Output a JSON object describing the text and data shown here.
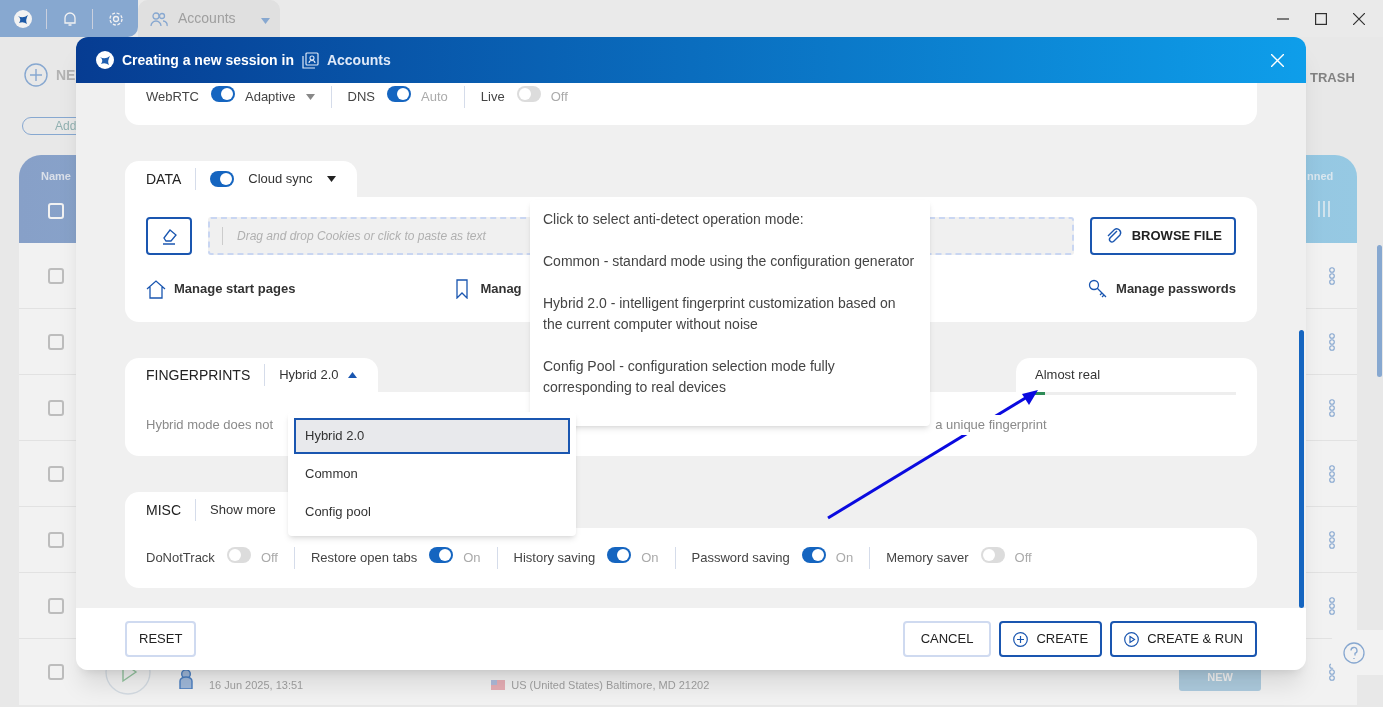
{
  "app": {
    "tab": {
      "label": "Accounts"
    },
    "toolbar": {
      "new_label": "NE",
      "add_label": "Add",
      "trash_label": "TRASH"
    },
    "table": {
      "header_checked": false,
      "columns": [
        {
          "label": "Name"
        },
        {
          "label": "nned"
        }
      ],
      "rows": [
        {
          "checked": false
        },
        {
          "checked": false
        },
        {
          "checked": false
        },
        {
          "checked": false
        },
        {
          "checked": false
        },
        {
          "checked": false
        }
      ],
      "last_row": {
        "checked": false,
        "date": "16 Jun 2025, 13:51",
        "location": "US (United States) Baltimore, MD 21202",
        "badge": "NEW"
      }
    }
  },
  "dialog": {
    "title": "Creating a new session in",
    "folder": "Accounts",
    "network": [
      {
        "label": "WebRTC",
        "on": true,
        "value": "Adaptive",
        "kind": "dropdown"
      },
      {
        "label": "DNS",
        "on": true,
        "value": "Auto",
        "kind": "plain"
      },
      {
        "label": "Live",
        "on": false,
        "value": "Off",
        "kind": "plain"
      }
    ],
    "data": {
      "title": "DATA",
      "cloud_sync": {
        "on": true,
        "label": "Cloud sync"
      },
      "cookies_placeholder": "Drag and drop Cookies or click to paste as text",
      "browse_button": "BROWSE FILE",
      "links": [
        {
          "kind": "house",
          "label": "Manage start pages"
        },
        {
          "kind": "bookmark",
          "label": "Manag"
        },
        {
          "kind": "key",
          "label": "Manage passwords"
        }
      ]
    },
    "fingerprints": {
      "title": "FINGERPRINTS",
      "mode": "Hybrid 2.0",
      "expanded": true,
      "description_start": "Hybrid mode does not",
      "description_end": "a unique fingerprint",
      "quality": {
        "label": "Almost real",
        "level": 0.05
      }
    },
    "mode_menu": [
      {
        "label": "Hybrid 2.0",
        "selected": true
      },
      {
        "label": "Common",
        "selected": false
      },
      {
        "label": "Config pool",
        "selected": false
      }
    ],
    "tooltip": [
      "Click to select anti-detect operation mode:",
      "Common - standard mode using the configuration generator",
      "Hybrid 2.0 - intelligent fingerprint customization based on the current computer without noise",
      "Config Pool - configuration selection mode fully corresponding to real devices"
    ],
    "misc": {
      "title": "MISC",
      "show_more": "Show more",
      "toggles": [
        {
          "label": "DoNotTrack",
          "on": false,
          "value": "Off"
        },
        {
          "label": "Restore open tabs",
          "on": true,
          "value": "On"
        },
        {
          "label": "History saving",
          "on": true,
          "value": "On"
        },
        {
          "label": "Password saving",
          "on": true,
          "value": "On"
        },
        {
          "label": "Memory saver",
          "on": false,
          "value": "Off"
        }
      ]
    },
    "footer": {
      "reset": "RESET",
      "cancel": "CANCEL",
      "create": "CREATE",
      "create_run": "CREATE & RUN"
    }
  }
}
